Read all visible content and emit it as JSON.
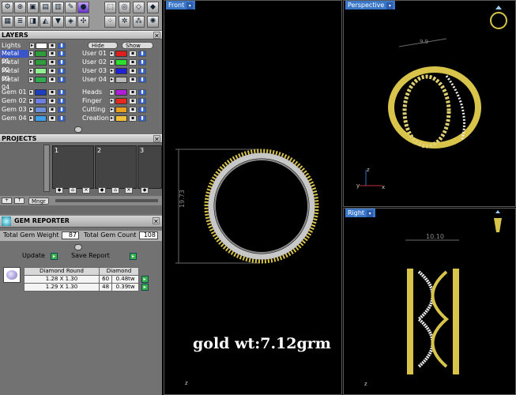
{
  "layers": {
    "title": "LAYERS",
    "lights_label": "Lights",
    "hide_label": "Hide",
    "show_label": "Show",
    "left_rows": [
      {
        "name": "Metal 01",
        "color": "#2f9d3c",
        "selected": true
      },
      {
        "name": "Metal 02",
        "color": "#2f9d3c",
        "selected": false
      },
      {
        "name": "Metal 03",
        "color": "#8ef08e",
        "selected": false
      },
      {
        "name": "Metal 04",
        "color": "#2faa4f",
        "selected": false
      },
      {
        "name": "Gem 01",
        "color": "#1e3fbf",
        "selected": false
      },
      {
        "name": "Gem 02",
        "color": "#6e7fe0",
        "selected": false
      },
      {
        "name": "Gem 03",
        "color": "#6d8fd8",
        "selected": false
      },
      {
        "name": "Gem 04",
        "color": "#3f9fe8",
        "selected": false
      }
    ],
    "right_rows": [
      {
        "name": "User 01",
        "color": "#e01e1e"
      },
      {
        "name": "User 02",
        "color": "#2ee02e"
      },
      {
        "name": "User 03",
        "color": "#2020d8"
      },
      {
        "name": "User 04",
        "color": "#b9b9b9"
      },
      {
        "name": "Heads",
        "color": "#b01ed8"
      },
      {
        "name": "Finger",
        "color": "#e8281e"
      },
      {
        "name": "Cutting",
        "color": "#e8a01e"
      },
      {
        "name": "Creation",
        "color": "#f0c03c"
      }
    ]
  },
  "projects": {
    "title": "PROJECTS",
    "slots": [
      "1",
      "2",
      "3"
    ],
    "mngr_label": "Mngr"
  },
  "gem_reporter": {
    "title": "GEM REPORTER",
    "total_weight_label": "Total Gem Weight",
    "total_weight_value": "87",
    "total_count_label": "Total Gem Count",
    "total_count_value": "108",
    "update_label": "Update",
    "save_report_label": "Save Report",
    "table_header": [
      "Diamond Round",
      "Diamond"
    ],
    "rows": [
      {
        "size": "1.28 X 1.30",
        "count": "60",
        "weight": "0.48tw"
      },
      {
        "size": "1.29 X 1.30",
        "count": "48",
        "weight": "0.39tw"
      }
    ]
  },
  "viewports": {
    "front": {
      "label": "Front",
      "dimension": "19.73"
    },
    "perspective": {
      "label": "Perspective",
      "dimension": "9.9"
    },
    "right": {
      "label": "Right",
      "dimension": "10.10"
    }
  },
  "axes": {
    "x": "x",
    "y": "y",
    "z": "z"
  },
  "caption": "gold wt:7.12grm",
  "colors": {
    "gold": "#d8c44a",
    "silver": "#c8c8c8",
    "dim_line": "#6a6a6a"
  }
}
